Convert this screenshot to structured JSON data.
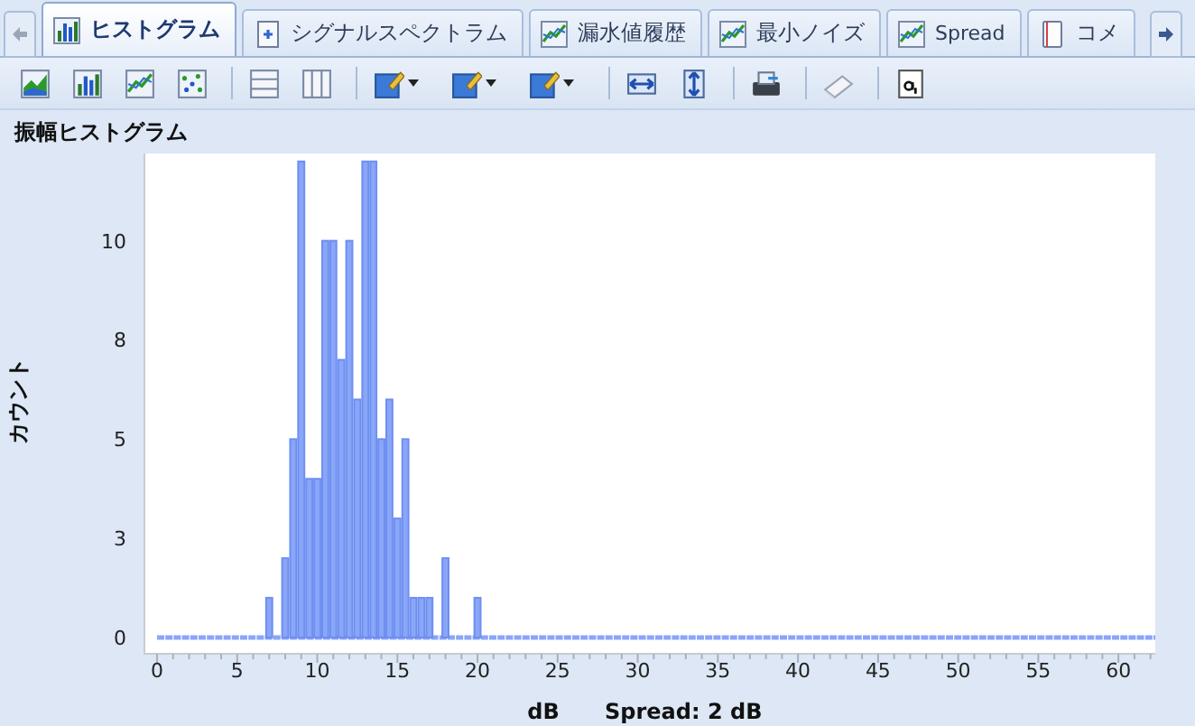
{
  "tabs": [
    {
      "label": "ヒストグラム",
      "selected": true
    },
    {
      "label": "シグナルスペクトラム",
      "selected": false
    },
    {
      "label": "漏水値履歴",
      "selected": false
    },
    {
      "label": "最小ノイズ",
      "selected": false
    },
    {
      "label": "Spread",
      "selected": false
    },
    {
      "label": "コメ",
      "selected": false
    }
  ],
  "panel_title": "振幅ヒストグラム",
  "chart_data": {
    "type": "bar",
    "xlabel": "dB",
    "ylabel": "カウント",
    "x": [
      7,
      7.5,
      8,
      8.5,
      9,
      9.5,
      10,
      10.5,
      11,
      11.5,
      12,
      12.5,
      13,
      13.5,
      14,
      14.5,
      15,
      15.5,
      16,
      16.5,
      17,
      17.5,
      18,
      18.5,
      19,
      19.5,
      20
    ],
    "series": [
      {
        "color": "#8aa6f7",
        "values": [
          1,
          0,
          2,
          5,
          12,
          4,
          4,
          10,
          10,
          7,
          10,
          6,
          12,
          12,
          5,
          6,
          3,
          5,
          1,
          1,
          1,
          0,
          2,
          0,
          0,
          0,
          1
        ]
      }
    ],
    "xlim": [
      0,
      62.3
    ],
    "ylim": [
      0,
      12.2
    ],
    "xticks": [
      0,
      5,
      10,
      15,
      20,
      25,
      30,
      35,
      40,
      45,
      50,
      55,
      60
    ],
    "yticks": [
      0,
      {
        "value": 2.5,
        "label": "3"
      },
      5,
      {
        "value": 7.5,
        "label": "8"
      },
      10
    ]
  },
  "footer_note": "Spread: 2 dB"
}
